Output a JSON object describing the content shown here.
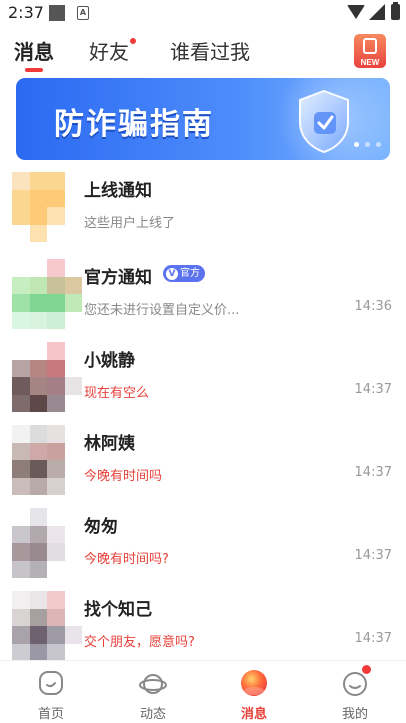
{
  "status_bar": {
    "time": "2:37"
  },
  "tabs": [
    {
      "label": "消息",
      "active": true
    },
    {
      "label": "好友",
      "active": false,
      "has_dot": true
    },
    {
      "label": "谁看过我",
      "active": false
    }
  ],
  "new_badge": {
    "text": "NEW"
  },
  "banner": {
    "title": "防诈骗指南"
  },
  "messages": [
    {
      "name": "上线通知",
      "preview": "这些用户上线了",
      "time": "",
      "preview_color": "gray",
      "avatar_colors": [
        "#fbe3bd",
        "#fbd690",
        "#fbd690",
        "#ffffff",
        "#fbd690",
        "#fdca78",
        "#fdca78",
        "#ffffff",
        "#fbd690",
        "#fdca78",
        "#fde2b0",
        "#ffffff",
        "#ffffff",
        "#fde2b0",
        "#ffffff",
        "#ffffff"
      ]
    },
    {
      "name": "官方通知",
      "badge": "官方",
      "preview": "您还未进行设置自定义价...",
      "time": "14:36",
      "preview_color": "gray",
      "avatar_colors": [
        "#ffffff",
        "#ffffff",
        "#f7c8cc",
        "#ffffff",
        "#c6eec0",
        "#bfe6b3",
        "#c8c29a",
        "#dcc8a0",
        "#9fe2a8",
        "#7fd690",
        "#7fd690",
        "#bfeab8",
        "#d9f6e3",
        "#d8f4de",
        "#cdeed5",
        "#ffffff"
      ]
    },
    {
      "name": "小姚静",
      "preview": "现在有空么",
      "time": "14:37",
      "preview_color": "red",
      "avatar_colors": [
        "#ffffff",
        "#ffffff",
        "#f6c5c9",
        "#ffffff",
        "#b8a4a2",
        "#b68584",
        "#c6787c",
        "#ffffff",
        "#6f5b5b",
        "#a58484",
        "#a48086",
        "#e7e4e6",
        "#7e6b6c",
        "#5e4747",
        "#998a91",
        "#ffffff"
      ]
    },
    {
      "name": "林阿姨",
      "preview": "今晚有时间吗",
      "time": "14:37",
      "preview_color": "red",
      "avatar_colors": [
        "#f2f2f2",
        "#dcdcdc",
        "#e8e0e0",
        "#ffffff",
        "#c8b9b5",
        "#cfa9a7",
        "#c9a19f",
        "#ffffff",
        "#8f7d79",
        "#6a5a58",
        "#b9aca9",
        "#ffffff",
        "#c9bcb9",
        "#b7aaa7",
        "#d6d0cf",
        "#ffffff"
      ]
    },
    {
      "name": "匆匆",
      "preview": "今晚有时间吗?",
      "time": "14:37",
      "preview_color": "red",
      "avatar_colors": [
        "#ffffff",
        "#e6e6ea",
        "#ffffff",
        "#ffffff",
        "#c9c6cc",
        "#b2a9ad",
        "#ebe4e8",
        "#ffffff",
        "#a8989c",
        "#998a90",
        "#e2dde0",
        "#ffffff",
        "#c6c4c9",
        "#b3b0b6",
        "#ffffff",
        "#ffffff"
      ]
    },
    {
      "name": "找个知己",
      "preview": "交个朋友，愿意吗?",
      "time": "14:37",
      "preview_color": "red",
      "avatar_colors": [
        "#f2eff0",
        "#eae6e7",
        "#f1c9cb",
        "#ffffff",
        "#d9d4d4",
        "#a8a0a0",
        "#dcb6b7",
        "#ffffff",
        "#a8a3ab",
        "#6e6270",
        "#9e9aa6",
        "#e8e4ea",
        "#cdccd2",
        "#9a98a4",
        "#c6c4cc",
        "#ffffff"
      ]
    }
  ],
  "bottom_nav": [
    {
      "label": "首页",
      "icon": "home-icon",
      "active": false
    },
    {
      "label": "动态",
      "icon": "planet-icon",
      "active": false
    },
    {
      "label": "消息",
      "icon": "message-orb-icon",
      "active": true
    },
    {
      "label": "我的",
      "icon": "profile-face-icon",
      "active": false,
      "has_dot": true
    }
  ],
  "colors": {
    "accent": "#f23a3a",
    "banner_blue": "#2b69f2",
    "official_badge": "#5b73ee"
  }
}
